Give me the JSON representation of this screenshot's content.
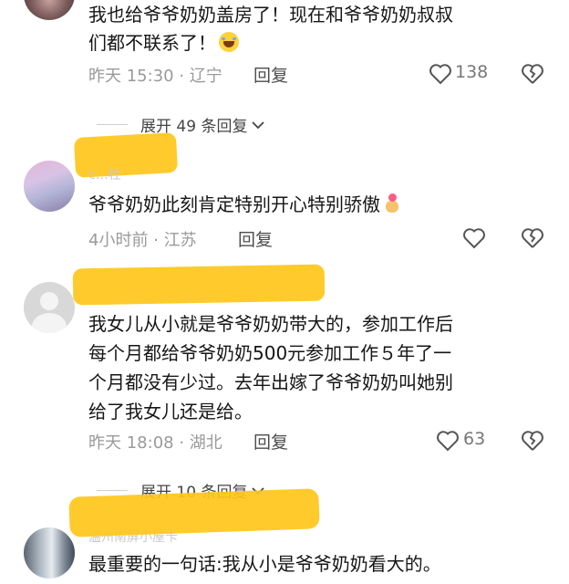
{
  "comments": [
    {
      "lines": [
        "我也给爷爷奶奶盖房了！现在和爷爷奶奶叔叔",
        "们都不联系了！"
      ],
      "emoji": "laughing-face",
      "time": "昨天 15:30",
      "location": "辽宁",
      "reply_label": "回复",
      "likes": "138"
    },
    {
      "username": "c…杜",
      "lines": [
        "爷爷奶奶此刻肯定特别开心特别骄傲"
      ],
      "emoji": "crossed-fingers-heart",
      "time": "4小时前",
      "location": "江苏",
      "reply_label": "回复"
    },
    {
      "lines": [
        "我女儿从小就是爷爷奶奶带大的，参加工作后",
        "每个月都给爷爷奶奶500元参加工作５年了一",
        "个月都没有少过。去年出嫁了爷爷奶奶叫她别",
        "给了我女儿还是给。"
      ],
      "time": "昨天 18:08",
      "location": "湖北",
      "reply_label": "回复",
      "likes": "63"
    },
    {
      "username": "温州南屏小屋卡",
      "lines": [
        "最重要的一句话:我从小是爷爷奶奶看大的。"
      ]
    }
  ],
  "expand_1": "展开 49 条回复",
  "expand_2": "展开 10 条回复",
  "colors": {
    "highlight": "#ffc71a",
    "meta": "#9a9a9a"
  }
}
